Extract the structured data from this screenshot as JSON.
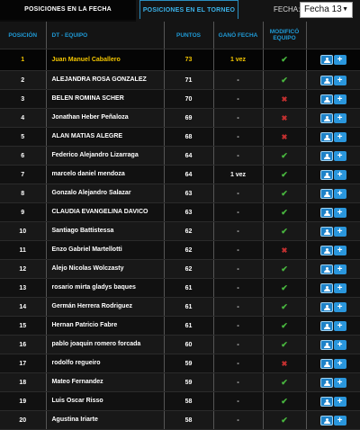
{
  "tabs": {
    "active": "POSICIONES EN LA FECHA",
    "inactive": "POSICIONES EN EL TORNEO"
  },
  "fecha": {
    "label": "FECHA:",
    "selected": "Fecha 13"
  },
  "columns": {
    "pos": "POSICIÓN",
    "team": "DT - EQUIPO",
    "pts": "PUNTOS",
    "won1": "GANÓ FECHA",
    "mod1": "MODIFICÓ",
    "mod2": "EQUIPO"
  },
  "icons": {
    "ok": "✔",
    "no": "✖",
    "plus": "+"
  },
  "colors": {
    "accent": "#1f9ad6",
    "leader": "#f2c500",
    "ok": "#49b83f",
    "no": "#c53030"
  },
  "rows": [
    {
      "pos": "1",
      "name": "Juan Manuel Caballero",
      "pts": "73",
      "won": "1 vez",
      "mod": "ok"
    },
    {
      "pos": "2",
      "name": "ALEJANDRA ROSA GONZALEZ",
      "pts": "71",
      "won": "-",
      "mod": "ok"
    },
    {
      "pos": "3",
      "name": "BELEN ROMINA SCHER",
      "pts": "70",
      "won": "-",
      "mod": "no"
    },
    {
      "pos": "4",
      "name": "Jonathan Heber Peñaloza",
      "pts": "69",
      "won": "-",
      "mod": "no"
    },
    {
      "pos": "5",
      "name": "ALAN MATIAS ALEGRE",
      "pts": "68",
      "won": "-",
      "mod": "no"
    },
    {
      "pos": "6",
      "name": "Federico Alejandro Lizarraga",
      "pts": "64",
      "won": "-",
      "mod": "ok"
    },
    {
      "pos": "7",
      "name": "marcelo daniel mendoza",
      "pts": "64",
      "won": "1 vez",
      "mod": "ok"
    },
    {
      "pos": "8",
      "name": "Gonzalo Alejandro Salazar",
      "pts": "63",
      "won": "-",
      "mod": "ok"
    },
    {
      "pos": "9",
      "name": "CLAUDIA EVANGELINA DAVICO",
      "pts": "63",
      "won": "-",
      "mod": "ok"
    },
    {
      "pos": "10",
      "name": "Santiago Battistessa",
      "pts": "62",
      "won": "-",
      "mod": "ok"
    },
    {
      "pos": "11",
      "name": "Enzo Gabriel Martellotti",
      "pts": "62",
      "won": "-",
      "mod": "no"
    },
    {
      "pos": "12",
      "name": "Alejo Nicolas Wolczasty",
      "pts": "62",
      "won": "-",
      "mod": "ok"
    },
    {
      "pos": "13",
      "name": "rosario mirta gladys baques",
      "pts": "61",
      "won": "-",
      "mod": "ok"
    },
    {
      "pos": "14",
      "name": "Germán Herrera Rodriguez",
      "pts": "61",
      "won": "-",
      "mod": "ok"
    },
    {
      "pos": "15",
      "name": "Hernan Patricio Fabre",
      "pts": "61",
      "won": "-",
      "mod": "ok"
    },
    {
      "pos": "16",
      "name": "pablo joaquin romero forcada",
      "pts": "60",
      "won": "-",
      "mod": "ok"
    },
    {
      "pos": "17",
      "name": "rodolfo regueiro",
      "pts": "59",
      "won": "-",
      "mod": "no"
    },
    {
      "pos": "18",
      "name": "Mateo Fernandez",
      "pts": "59",
      "won": "-",
      "mod": "ok"
    },
    {
      "pos": "19",
      "name": "Luis Oscar Risso",
      "pts": "58",
      "won": "-",
      "mod": "ok"
    },
    {
      "pos": "20",
      "name": "Agustina Iriarte",
      "pts": "58",
      "won": "-",
      "mod": "ok"
    }
  ]
}
